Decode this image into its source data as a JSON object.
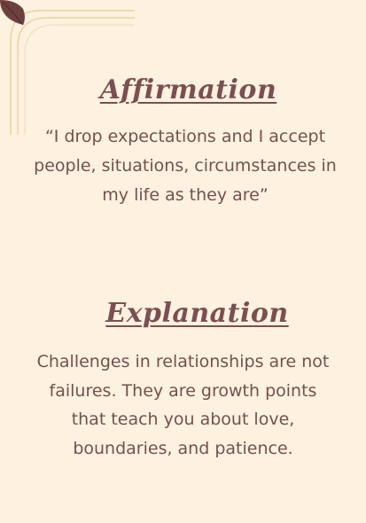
{
  "affirmation": {
    "heading": "Affirmation",
    "quote": "“I drop expectations and I accept people, situations, circumstances in my life as they are”"
  },
  "explanation": {
    "heading": "Explanation",
    "text": "Challenges in relationships are not failures. They are growth points that teach you about love, boundaries, and patience."
  },
  "colors": {
    "background": "#fdf1e0",
    "text": "#74504f",
    "heading": "#7b4f52",
    "leaf": "#6e4040",
    "deco_line": "#e9d2a0"
  },
  "icons": {
    "corner": "leaf-icon"
  }
}
